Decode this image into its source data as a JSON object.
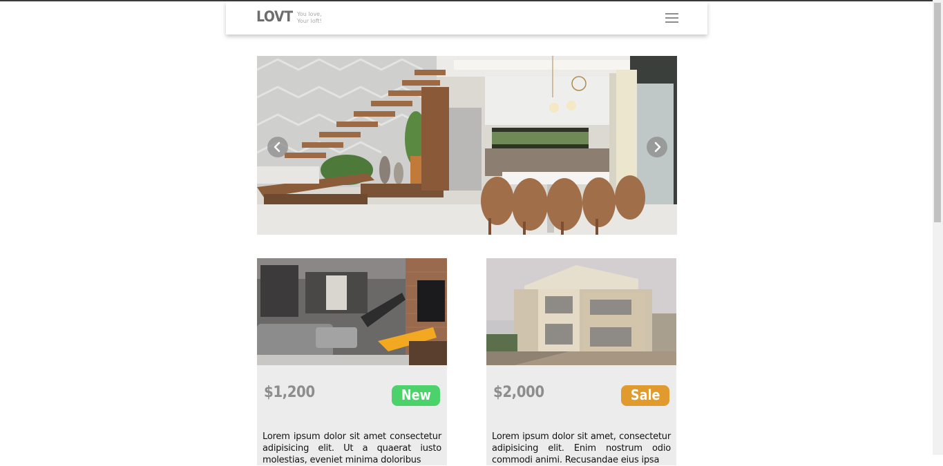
{
  "header": {
    "logo": "LOVT",
    "tagline_line1": "You love,",
    "tagline_line2": "Your loft!",
    "menu_icon": "hamburger-menu-icon"
  },
  "carousel": {
    "prev_icon": "chevron-left-icon",
    "next_icon": "chevron-right-icon"
  },
  "listings": [
    {
      "price": "$1,200",
      "badge": "New",
      "badge_color": "#4cd26b",
      "description": "Lorem ipsum dolor sit amet consectetur adipisicing elit. Ut a quaerat iusto molestias, eveniet minima doloribus"
    },
    {
      "price": "$2,000",
      "badge": "Sale",
      "badge_color": "#e09a2e",
      "description": "Lorem ipsum dolor sit amet, consectetur adipisicing elit. Enim nostrum odio commodi animi. Recusandae eius ipsa"
    }
  ],
  "colors": {
    "logo": "#6d6d6d",
    "price": "#8d8d8d",
    "card_bg": "#ececec"
  }
}
